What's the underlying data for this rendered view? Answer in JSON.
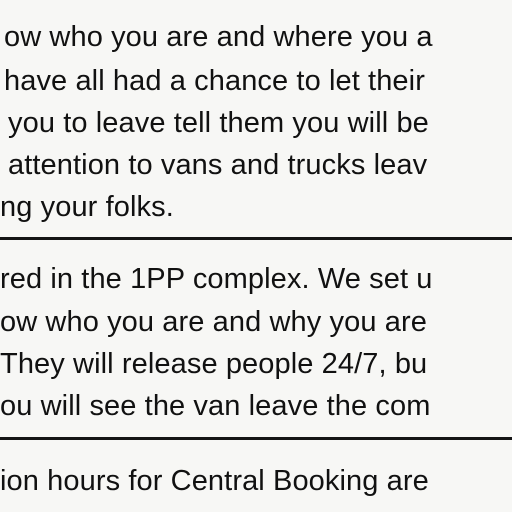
{
  "document": {
    "section1": {
      "lines": [
        "ow who you are and where you a",
        "have all had a chance to let their",
        "you to leave tell them you will be",
        "attention to vans and trucks leav",
        "ng your folks."
      ]
    },
    "section2": {
      "lines": [
        "red in the 1PP complex.  We set u",
        "ow who you are and why you are",
        "They will release people 24/7, bu",
        "ou will see the van leave the com"
      ]
    },
    "section3": {
      "lines": [
        "ion hours for Central Booking are"
      ]
    }
  }
}
